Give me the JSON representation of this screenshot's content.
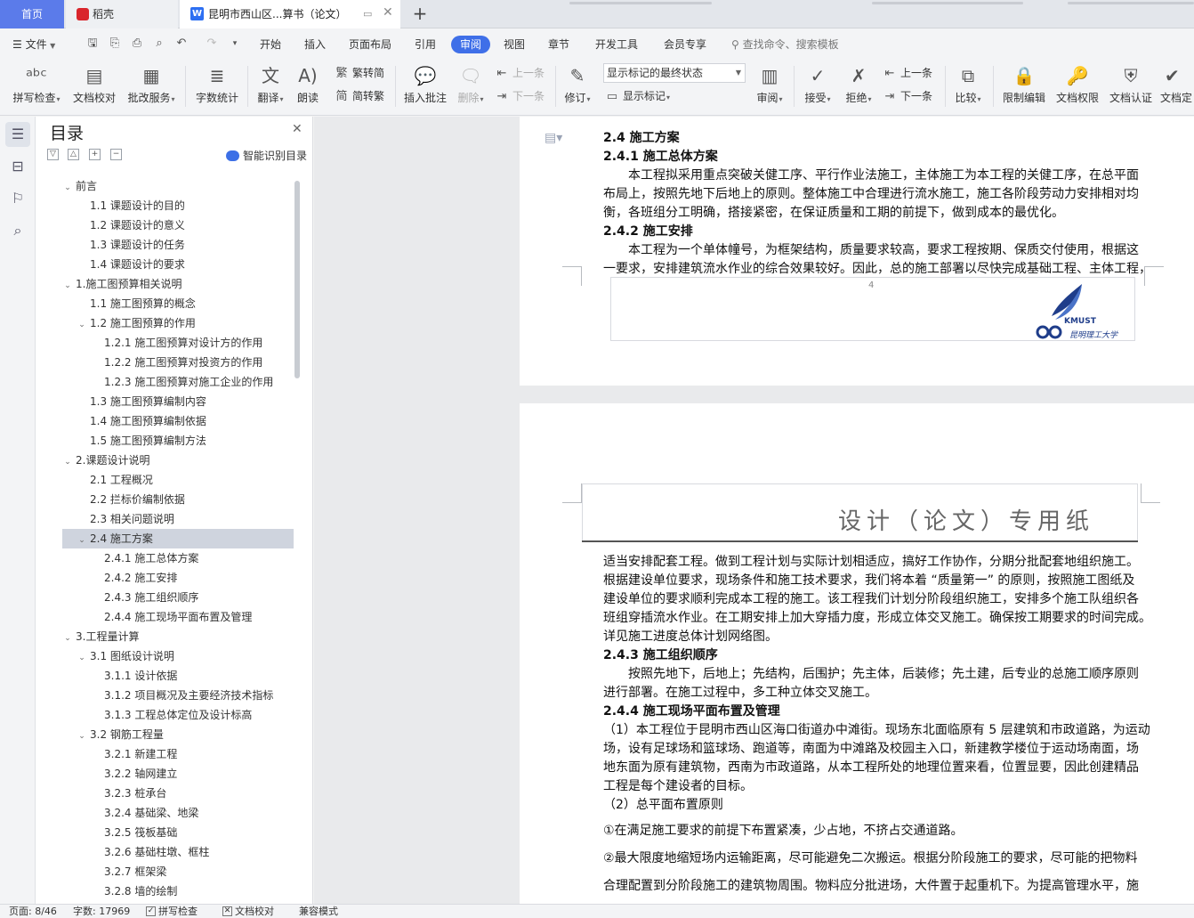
{
  "tabs": {
    "home": "首页",
    "docer": "稻壳",
    "doc": "昆明市西山区...算书（论文）",
    "add": "+"
  },
  "menu": {
    "file": "文件",
    "items": [
      "开始",
      "插入",
      "页面布局",
      "引用",
      "审阅",
      "视图",
      "章节",
      "开发工具",
      "会员专享"
    ],
    "active": "审阅",
    "search": "查找命令、搜索模板"
  },
  "ribbon": {
    "spell": "拼写检查",
    "doc_check": "文档校对",
    "annotate_service": "批改服务",
    "word_count": "字数统计",
    "translate": "翻译",
    "read": "朗读",
    "trad": "繁转简",
    "simp": "简转繁",
    "insert_comment": "插入批注",
    "delete": "删除",
    "prev_comment": "上一条",
    "next_comment": "下一条",
    "revise": "修订",
    "markup_select": "显示标记的最终状态",
    "show_markup": "显示标记",
    "review": "审阅",
    "accept": "接受",
    "reject": "拒绝",
    "prev": "上一条",
    "next": "下一条",
    "compare": "比较",
    "restrict": "限制编辑",
    "permission": "文档权限",
    "certify": "文档认证",
    "finalize": "文档定"
  },
  "toc": {
    "title": "目录",
    "smart": "智能识别目录",
    "items": [
      {
        "text": "前言",
        "level": 0,
        "arrow": "open"
      },
      {
        "text": "1.1 课题设计的目的",
        "level": 1
      },
      {
        "text": "1.2 课题设计的意义",
        "level": 1
      },
      {
        "text": "1.3 课题设计的任务",
        "level": 1
      },
      {
        "text": "1.4 课题设计的要求",
        "level": 1
      },
      {
        "text": "1.施工图预算相关说明",
        "level": 0,
        "arrow": "open"
      },
      {
        "text": "1.1 施工图预算的概念",
        "level": 1
      },
      {
        "text": "1.2 施工图预算的作用",
        "level": 1,
        "arrow": "open"
      },
      {
        "text": "1.2.1 施工图预算对设计方的作用",
        "level": 2
      },
      {
        "text": "1.2.2 施工图预算对投资方的作用",
        "level": 2
      },
      {
        "text": "1.2.3 施工图预算对施工企业的作用",
        "level": 2
      },
      {
        "text": "1.3 施工图预算编制内容",
        "level": 1
      },
      {
        "text": "1.4 施工图预算编制依据",
        "level": 1
      },
      {
        "text": "1.5 施工图预算编制方法",
        "level": 1
      },
      {
        "text": "2.课题设计说明",
        "level": 0,
        "arrow": "open"
      },
      {
        "text": "2.1 工程概况",
        "level": 1
      },
      {
        "text": "2.2 拦标价编制依据",
        "level": 1
      },
      {
        "text": "2.3 相关问题说明",
        "level": 1
      },
      {
        "text": "2.4 施工方案",
        "level": 1,
        "arrow": "open",
        "selected": true
      },
      {
        "text": "2.4.1 施工总体方案",
        "level": 2
      },
      {
        "text": "2.4.2 施工安排",
        "level": 2
      },
      {
        "text": "2.4.3 施工组织顺序",
        "level": 2
      },
      {
        "text": "2.4.4 施工现场平面布置及管理",
        "level": 2
      },
      {
        "text": "3.工程量计算",
        "level": 0,
        "arrow": "open"
      },
      {
        "text": "3.1 图纸设计说明",
        "level": 1,
        "arrow": "open"
      },
      {
        "text": "3.1.1 设计依据",
        "level": 2
      },
      {
        "text": "3.1.2 项目概况及主要经济技术指标",
        "level": 2
      },
      {
        "text": "3.1.3 工程总体定位及设计标高",
        "level": 2
      },
      {
        "text": "3.2 钢筋工程量",
        "level": 1,
        "arrow": "open"
      },
      {
        "text": "3.2.1 新建工程",
        "level": 2
      },
      {
        "text": "3.2.2 轴网建立",
        "level": 2
      },
      {
        "text": "3.2.3 桩承台",
        "level": 2
      },
      {
        "text": "3.2.4 基础梁、地梁",
        "level": 2
      },
      {
        "text": "3.2.5 筏板基础",
        "level": 2
      },
      {
        "text": "3.2.6 基础柱墩、框柱",
        "level": 2
      },
      {
        "text": "3.2.7 框架梁",
        "level": 2
      },
      {
        "text": "3.2.8 墙的绘制",
        "level": 2
      }
    ]
  },
  "doc": {
    "page1_lines": [
      {
        "text": "2.4 施工方案",
        "bold": true
      },
      {
        "text": "2.4.1 施工总体方案",
        "bold": true
      },
      {
        "text": "　　本工程拟采用重点突破关健工序、平行作业法施工，主体施工为本工程的关健工序，在总平面"
      },
      {
        "text": "布局上，按照先地下后地上的原则。整体施工中合理进行流水施工，施工各阶段劳动力安排相对均"
      },
      {
        "text": "衡，各班组分工明确，搭接紧密，在保证质量和工期的前提下，做到成本的最优化。"
      },
      {
        "text": "2.4.2 施工安排",
        "bold": true
      },
      {
        "text": "　　本工程为一个单体幢号，为框架结构，质量要求较高，要求工程按期、保质交付使用，根据这"
      },
      {
        "text": "一要求，安排建筑流水作业的综合效果较好。因此，总的施工部署以尽快完成基础工程、主体工程，"
      }
    ],
    "page_number": "4",
    "logo_text": "KMUST",
    "logo_cn": "昆明理工大学",
    "page2_header": "设计（论文）专用纸",
    "page2_lines": [
      {
        "text": "适当安排配套工程。做到工程计划与实际计划相适应，搞好工作协作，分期分批配套地组织施工。"
      },
      {
        "text": "根据建设单位要求，现场条件和施工技术要求，我们将本着 “质量第一” 的原则，按照施工图纸及"
      },
      {
        "text": "建设单位的要求顺利完成本工程的施工。该工程我们计划分阶段组织施工，安排多个施工队组织各"
      },
      {
        "text": "班组穿插流水作业。在工期安排上加大穿插力度，形成立体交叉施工。确保按工期要求的时间完成。"
      },
      {
        "text": "详见施工进度总体计划网络图。"
      },
      {
        "text": "2.4.3 施工组织顺序",
        "bold": true
      },
      {
        "text": "　　按照先地下，后地上；先结构，后围护；先主体，后装修；先土建，后专业的总施工顺序原则"
      },
      {
        "text": "进行部署。在施工过程中，多工种立体交叉施工。"
      },
      {
        "text": "2.4.4 施工现场平面布置及管理",
        "bold": true
      },
      {
        "text": "（1）本工程位于昆明市西山区海口街道办中滩街。现场东北面临原有 5 层建筑和市政道路，为运动"
      },
      {
        "text": "场，设有足球场和篮球场、跑道等，南面为中滩路及校园主入口，新建教学楼位于运动场南面，场"
      },
      {
        "text": "地东面为原有建筑物，西南为市政道路，从本工程所处的地理位置来看，位置显要，因此创建精品"
      },
      {
        "text": "工程是每个建设者的目标。"
      },
      {
        "text": "（2）总平面布置原则"
      },
      {
        "text": "①在满足施工要求的前提下布置紧凑，少占地，不挤占交通道路。"
      },
      {
        "text": "②最大限度地缩短场内运输距离，尽可能避免二次搬运。根据分阶段施工的要求，尽可能的把物料"
      },
      {
        "text": "合理配置到分阶段施工的建筑物周围。物料应分批进场，大件置于起重机下。为提高管理水平，施"
      }
    ]
  },
  "status": {
    "page": "页面: 8/46",
    "words": "字数: 17969",
    "spell": "拼写检查",
    "check": "文档校对",
    "compat": "兼容模式"
  }
}
